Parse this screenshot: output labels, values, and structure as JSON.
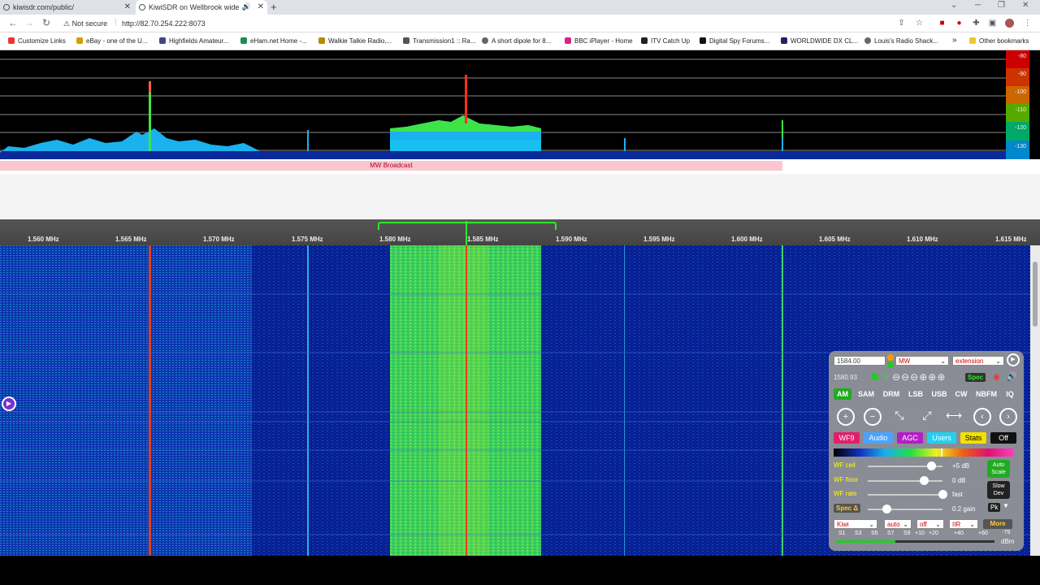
{
  "browser": {
    "tabs": [
      {
        "title": "kiwisdr.com/public/",
        "active": false
      },
      {
        "title": "KiwiSDR on Wellbrook wide",
        "active": true
      }
    ],
    "security_label": "Not secure",
    "url": "http://82.70.254.222:8073",
    "bookmarks": [
      "Customize Links",
      "eBay - one of the U...",
      "Highfields Amateur...",
      "eHam.net Home -...",
      "Walkie Talkie Radio,...",
      "Transmission1 :: Ra...",
      "A short dipole for 8...",
      "BBC iPlayer - Home",
      "ITV Catch Up",
      "Digital Spy Forums...",
      "WORLDWIDE DX CL...",
      "Louis's Radio Shack...",
      "Other bookmarks"
    ]
  },
  "spectrum": {
    "db_scale": [
      "-80",
      "-90",
      "-100",
      "-110",
      "-120",
      "-130"
    ],
    "db_colors": [
      "#cc0000",
      "#cc3300",
      "#cc6600",
      "#55aa00",
      "#00aa66",
      "#0088cc"
    ]
  },
  "band": {
    "label": "MW Broadcast"
  },
  "freq_scale": [
    "1.560 MHz",
    "1.565 MHz",
    "1.570 MHz",
    "1.575 MHz",
    "1.580 MHz",
    "1.585 MHz",
    "1.590 MHz",
    "1.595 MHz",
    "1.600 MHz",
    "1.605 MHz",
    "1.610 MHz",
    "1.615 MHz"
  ],
  "control_panel": {
    "freq_input": "1584.00",
    "band_select": "MW",
    "extension_select": "extension",
    "freq_readout": "1580.93",
    "step_value": "9",
    "spec_label": "Spec",
    "modes": [
      "AM",
      "SAM",
      "DRM",
      "LSB",
      "USB",
      "CW",
      "NBFM",
      "IQ"
    ],
    "tabs": [
      {
        "label": "WF9",
        "bg": "#e0206a",
        "fg": "#ffffff"
      },
      {
        "label": "Audio",
        "bg": "#4aa3ff",
        "fg": "#ffffff"
      },
      {
        "label": "AGC",
        "bg": "#b41ec8",
        "fg": "#ffffff"
      },
      {
        "label": "Users",
        "bg": "#22d0f0",
        "fg": "#ffffff"
      },
      {
        "label": "Stats",
        "bg": "#f5e000",
        "fg": "#000000"
      },
      {
        "label": "Off",
        "bg": "#111111",
        "fg": "#ffffff"
      }
    ],
    "wf_ceil": {
      "label": "WF ceil",
      "value": "+5 dB",
      "level": 0.85
    },
    "wf_floor": {
      "label": "WF floor",
      "value": "0 dB",
      "level": 0.75
    },
    "wf_rate": {
      "label": "WF rate",
      "value": "fast",
      "level": 1.0
    },
    "spec_delta": {
      "label": "Spec Δ",
      "value": "0.2 gain",
      "level": 0.25
    },
    "auto_scale": "Auto Scale",
    "slow_dev": "Slow Dev",
    "pk": "Pk",
    "selects": [
      "Kiwi",
      "auto",
      "off",
      "IIR"
    ],
    "more": "More",
    "smeter_labels": [
      "S1",
      "S3",
      "S5",
      "S7",
      "S9",
      "+10",
      "+20",
      "+40",
      "+60"
    ],
    "smeter_reading": "-79",
    "smeter_unit": "dBm"
  }
}
